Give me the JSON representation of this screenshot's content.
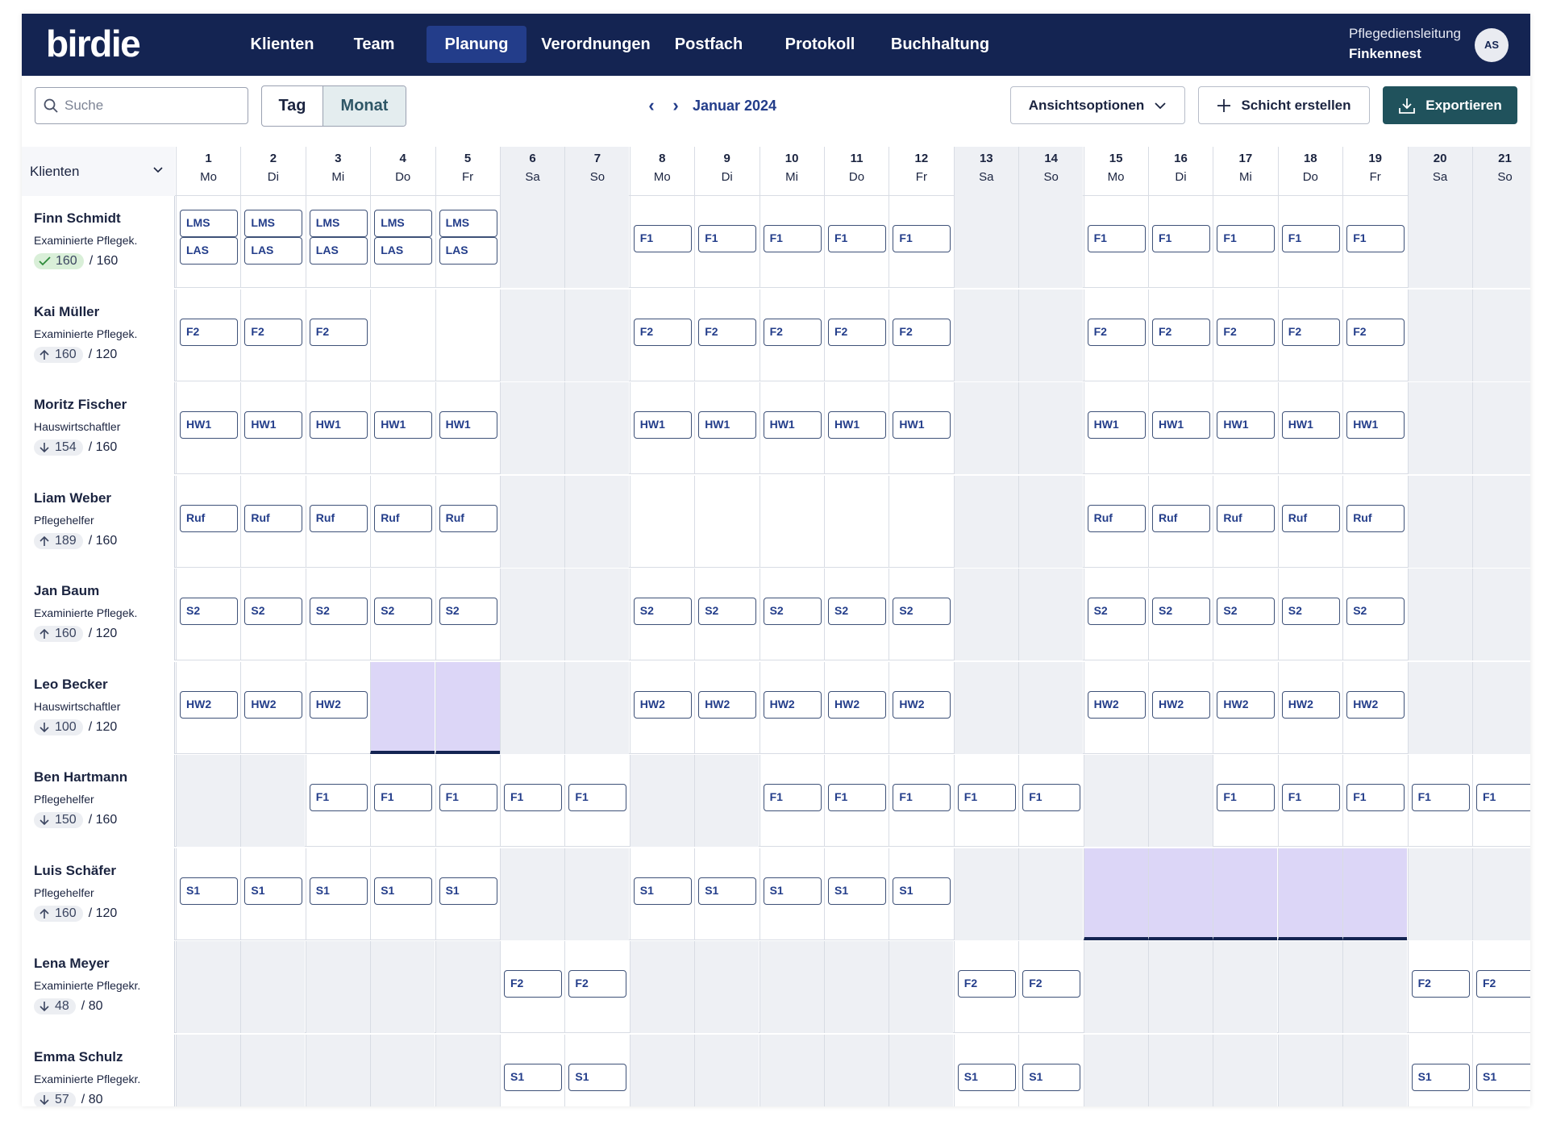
{
  "app": {
    "logo": "birdie",
    "nav": [
      {
        "label": "Klienten",
        "left": 0
      },
      {
        "label": "Team"
      },
      {
        "label": "Planung",
        "active": true
      },
      {
        "label": "Verordnungen"
      },
      {
        "label": "Postfach"
      },
      {
        "label": "Protokoll"
      },
      {
        "label": "Buchhaltung"
      }
    ],
    "org_role": "Pflegediensleitung",
    "org_name": "Finkennest",
    "avatar_initials": "AS"
  },
  "toolbar": {
    "search_placeholder": "Suche",
    "view_tag": "Tag",
    "view_monat": "Monat",
    "month_label": "Januar 2024",
    "view_options_label": "Ansichtsoptionen",
    "create_label": "Schicht erstellen",
    "export_label": "Exportieren"
  },
  "grid": {
    "client_filter_label": "Klienten",
    "days": [
      {
        "n": "1",
        "w": "Mo"
      },
      {
        "n": "2",
        "w": "Di"
      },
      {
        "n": "3",
        "w": "Mi"
      },
      {
        "n": "4",
        "w": "Do"
      },
      {
        "n": "5",
        "w": "Fr"
      },
      {
        "n": "6",
        "w": "Sa",
        "we": true
      },
      {
        "n": "7",
        "w": "So",
        "we": true
      },
      {
        "n": "8",
        "w": "Mo"
      },
      {
        "n": "9",
        "w": "Di"
      },
      {
        "n": "10",
        "w": "Mi"
      },
      {
        "n": "11",
        "w": "Do"
      },
      {
        "n": "12",
        "w": "Fr"
      },
      {
        "n": "13",
        "w": "Sa",
        "we": true
      },
      {
        "n": "14",
        "w": "So",
        "we": true
      },
      {
        "n": "15",
        "w": "Mo"
      },
      {
        "n": "16",
        "w": "Di"
      },
      {
        "n": "17",
        "w": "Mi"
      },
      {
        "n": "18",
        "w": "Do"
      },
      {
        "n": "19",
        "w": "Fr"
      },
      {
        "n": "20",
        "w": "Sa",
        "we": true
      },
      {
        "n": "21",
        "w": "So",
        "we": true
      }
    ],
    "employees": [
      {
        "name": "Finn Schmidt",
        "role": "Examinierte Pflegek.",
        "hours": "160",
        "target": "/ 160",
        "trend": "ok",
        "gray": [
          6,
          7,
          13,
          14,
          20,
          21
        ],
        "shifts": {
          "1": [
            "LMS",
            "LAS"
          ],
          "2": [
            "LMS",
            "LAS"
          ],
          "3": [
            "LMS",
            "LAS"
          ],
          "4": [
            "LMS",
            "LAS"
          ],
          "5": [
            "LMS",
            "LAS"
          ],
          "8": [
            "F1"
          ],
          "9": [
            "F1"
          ],
          "10": [
            "F1"
          ],
          "11": [
            "F1"
          ],
          "12": [
            "F1"
          ],
          "15": [
            "F1"
          ],
          "16": [
            "F1"
          ],
          "17": [
            "F1"
          ],
          "18": [
            "F1"
          ],
          "19": [
            "F1"
          ]
        }
      },
      {
        "name": "Kai Müller",
        "role": "Examinierte Pflegek.",
        "hours": "160",
        "target": "/ 120",
        "trend": "up",
        "gray": [
          6,
          7,
          13,
          14,
          20,
          21
        ],
        "shifts": {
          "1": [
            "F2"
          ],
          "2": [
            "F2"
          ],
          "3": [
            "F2"
          ],
          "8": [
            "F2"
          ],
          "9": [
            "F2"
          ],
          "10": [
            "F2"
          ],
          "11": [
            "F2"
          ],
          "12": [
            "F2"
          ],
          "15": [
            "F2"
          ],
          "16": [
            "F2"
          ],
          "17": [
            "F2"
          ],
          "18": [
            "F2"
          ],
          "19": [
            "F2"
          ]
        }
      },
      {
        "name": "Moritz Fischer",
        "role": "Hauswirtschaftler",
        "hours": "154",
        "target": "/ 160",
        "trend": "down",
        "gray": [
          6,
          7,
          13,
          14,
          20,
          21
        ],
        "shifts": {
          "1": [
            "HW1"
          ],
          "2": [
            "HW1"
          ],
          "3": [
            "HW1"
          ],
          "4": [
            "HW1"
          ],
          "5": [
            "HW1"
          ],
          "8": [
            "HW1"
          ],
          "9": [
            "HW1"
          ],
          "10": [
            "HW1"
          ],
          "11": [
            "HW1"
          ],
          "12": [
            "HW1"
          ],
          "15": [
            "HW1"
          ],
          "16": [
            "HW1"
          ],
          "17": [
            "HW1"
          ],
          "18": [
            "HW1"
          ],
          "19": [
            "HW1"
          ]
        }
      },
      {
        "name": "Liam Weber",
        "role": "Pflegehelfer",
        "hours": "189",
        "target": "/ 160",
        "trend": "up",
        "gray": [
          6,
          7,
          13,
          14,
          20,
          21
        ],
        "shifts": {
          "1": [
            "Ruf"
          ],
          "2": [
            "Ruf"
          ],
          "3": [
            "Ruf"
          ],
          "4": [
            "Ruf"
          ],
          "5": [
            "Ruf"
          ],
          "15": [
            "Ruf"
          ],
          "16": [
            "Ruf"
          ],
          "17": [
            "Ruf"
          ],
          "18": [
            "Ruf"
          ],
          "19": [
            "Ruf"
          ]
        }
      },
      {
        "name": "Jan Baum",
        "role": "Examinierte Pflegek.",
        "hours": "160",
        "target": "/ 120",
        "trend": "up",
        "gray": [
          6,
          7,
          13,
          14,
          20,
          21
        ],
        "shifts": {
          "1": [
            "S2"
          ],
          "2": [
            "S2"
          ],
          "3": [
            "S2"
          ],
          "4": [
            "S2"
          ],
          "5": [
            "S2"
          ],
          "8": [
            "S2"
          ],
          "9": [
            "S2"
          ],
          "10": [
            "S2"
          ],
          "11": [
            "S2"
          ],
          "12": [
            "S2"
          ],
          "15": [
            "S2"
          ],
          "16": [
            "S2"
          ],
          "17": [
            "S2"
          ],
          "18": [
            "S2"
          ],
          "19": [
            "S2"
          ]
        }
      },
      {
        "name": "Leo Becker",
        "role": "Hauswirtschaftler",
        "hours": "100",
        "target": "/ 120",
        "trend": "down",
        "gray": [
          6,
          7,
          13,
          14,
          20,
          21
        ],
        "highlight": [
          4,
          5
        ],
        "shifts": {
          "1": [
            "HW2"
          ],
          "2": [
            "HW2"
          ],
          "3": [
            "HW2"
          ],
          "8": [
            "HW2"
          ],
          "9": [
            "HW2"
          ],
          "10": [
            "HW2"
          ],
          "11": [
            "HW2"
          ],
          "12": [
            "HW2"
          ],
          "15": [
            "HW2"
          ],
          "16": [
            "HW2"
          ],
          "17": [
            "HW2"
          ],
          "18": [
            "HW2"
          ],
          "19": [
            "HW2"
          ]
        }
      },
      {
        "name": "Ben Hartmann",
        "role": "Pflegehelfer",
        "hours": "150",
        "target": "/ 160",
        "trend": "down",
        "gray": [
          1,
          2,
          8,
          9,
          15,
          16
        ],
        "shifts": {
          "3": [
            "F1"
          ],
          "4": [
            "F1"
          ],
          "5": [
            "F1"
          ],
          "6": [
            "F1"
          ],
          "7": [
            "F1"
          ],
          "10": [
            "F1"
          ],
          "11": [
            "F1"
          ],
          "12": [
            "F1"
          ],
          "13": [
            "F1"
          ],
          "14": [
            "F1"
          ],
          "17": [
            "F1"
          ],
          "18": [
            "F1"
          ],
          "19": [
            "F1"
          ],
          "20": [
            "F1"
          ],
          "21": [
            "F1"
          ]
        }
      },
      {
        "name": "Luis Schäfer",
        "role": "Pflegehelfer",
        "hours": "160",
        "target": "/ 120",
        "trend": "up",
        "gray": [
          6,
          7,
          13,
          14,
          20,
          21
        ],
        "highlight": [
          15,
          16,
          17,
          18,
          19
        ],
        "shifts": {
          "1": [
            "S1"
          ],
          "2": [
            "S1"
          ],
          "3": [
            "S1"
          ],
          "4": [
            "S1"
          ],
          "5": [
            "S1"
          ],
          "8": [
            "S1"
          ],
          "9": [
            "S1"
          ],
          "10": [
            "S1"
          ],
          "11": [
            "S1"
          ],
          "12": [
            "S1"
          ]
        }
      },
      {
        "name": "Lena Meyer",
        "role": "Examinierte Pflegekr.",
        "hours": "48",
        "target": "/ 80",
        "trend": "down",
        "gray": [
          1,
          2,
          3,
          4,
          5,
          8,
          9,
          10,
          11,
          12,
          15,
          16,
          17,
          18,
          19
        ],
        "shifts": {
          "6": [
            "F2"
          ],
          "7": [
            "F2"
          ],
          "13": [
            "F2"
          ],
          "14": [
            "F2"
          ],
          "20": [
            "F2"
          ],
          "21": [
            "F2"
          ]
        }
      },
      {
        "name": "Emma Schulz",
        "role": "Examinierte Pflegekr.",
        "hours": "57",
        "target": "/ 80",
        "trend": "down",
        "gray": [
          1,
          2,
          3,
          4,
          5,
          8,
          9,
          10,
          11,
          12,
          15,
          16,
          17,
          18,
          19
        ],
        "shifts": {
          "6": [
            "S1"
          ],
          "7": [
            "S1"
          ],
          "13": [
            "S1"
          ],
          "14": [
            "S1"
          ],
          "20": [
            "S1"
          ],
          "21": [
            "S1"
          ]
        }
      }
    ]
  }
}
